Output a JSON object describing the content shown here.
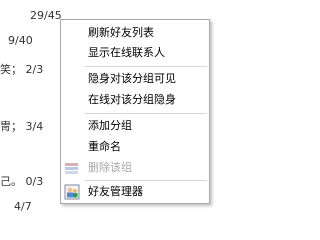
{
  "background": {
    "lines": [
      "29/45",
      "9/40",
      "笑；  2/3",
      "冑；  3/4",
      "己。 0/3",
      "4/7"
    ]
  },
  "context_menu": {
    "items": [
      {
        "label": "刷新好友列表",
        "disabled": false
      },
      {
        "label": "显示在线联系人",
        "disabled": false
      },
      {
        "label": "隐身对该分组可见",
        "disabled": false
      },
      {
        "label": "在线对该分组隐身",
        "disabled": false
      },
      {
        "label": "添加分组",
        "disabled": false
      },
      {
        "label": "重命名",
        "disabled": false
      },
      {
        "label": "删除该组",
        "disabled": true,
        "icon": "delete-group-icon"
      },
      {
        "label": "好友管理器",
        "disabled": false,
        "icon": "friend-manager-icon"
      }
    ]
  },
  "colors": {
    "menu_border": "#a9a9a9",
    "disabled_text": "#a8a8a8",
    "separator": "#d6d6d6"
  }
}
